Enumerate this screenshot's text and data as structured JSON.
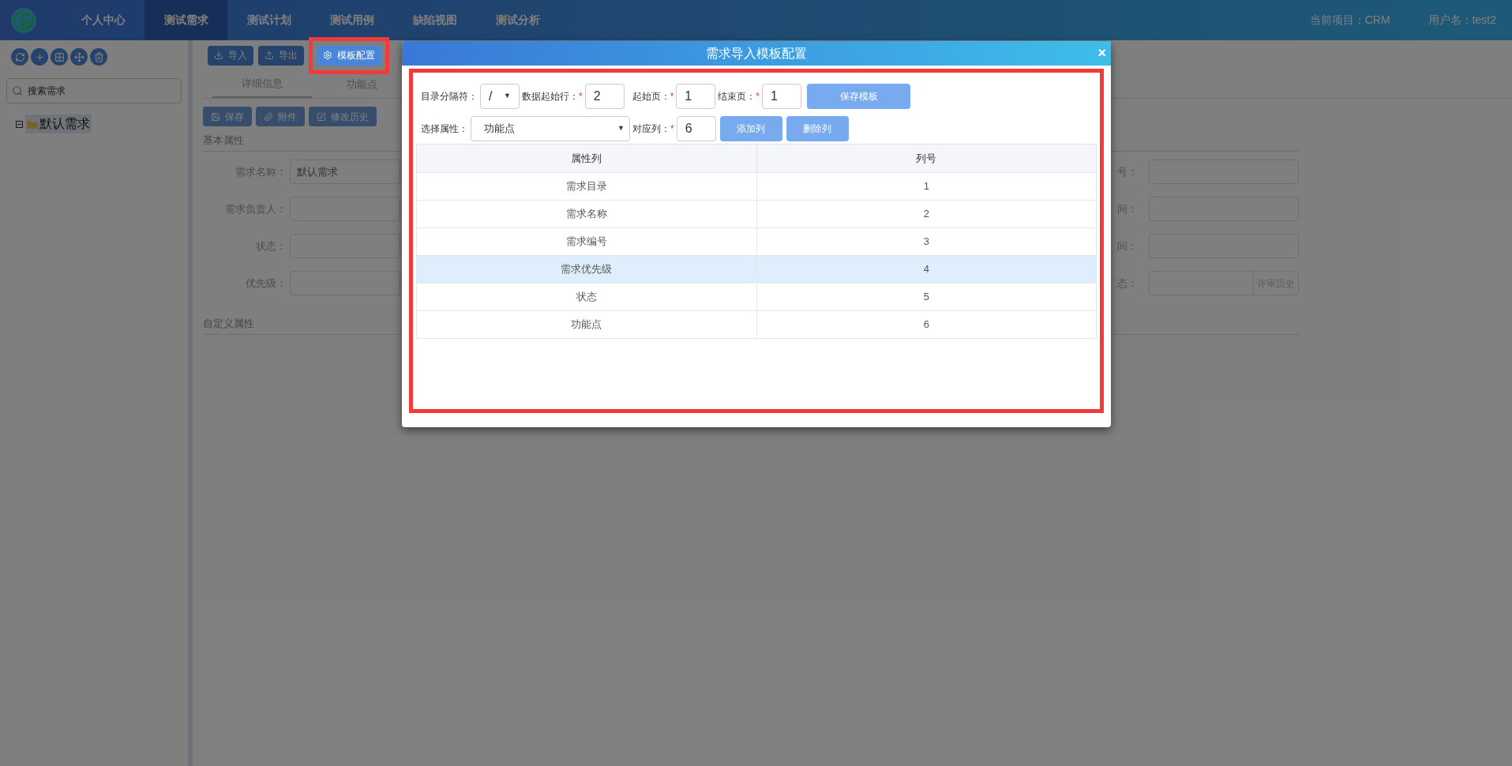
{
  "nav": {
    "items": [
      {
        "label": "个人中心",
        "selected": false
      },
      {
        "label": "测试需求",
        "selected": true
      },
      {
        "label": "测试计划",
        "selected": false
      },
      {
        "label": "测试用例",
        "selected": false
      },
      {
        "label": "缺陷视图",
        "selected": false
      },
      {
        "label": "测试分析",
        "selected": false
      }
    ],
    "project": "当前项目：CRM",
    "user": "用户名：test2"
  },
  "sidebar": {
    "tools": [
      {
        "kind": "refresh"
      },
      {
        "kind": "add"
      },
      {
        "kind": "grid"
      },
      {
        "kind": "move"
      },
      {
        "kind": "delete"
      }
    ],
    "search": {
      "placeholder": "搜索需求"
    },
    "tree": [
      {
        "label": "默认需求",
        "expanded": true,
        "selected": true
      }
    ]
  },
  "toolbar": [
    {
      "kind": "import",
      "label": "导入",
      "highlighted": false
    },
    {
      "kind": "export",
      "label": "导出",
      "highlighted": false
    },
    {
      "kind": "settings",
      "label": "模板配置",
      "highlighted": true
    }
  ],
  "detail": {
    "tabs": [
      {
        "label": "详细信息",
        "selected": true
      },
      {
        "label": "功能点",
        "selected": false
      }
    ],
    "actions": [
      {
        "kind": "save",
        "label": "保存"
      },
      {
        "kind": "attach",
        "label": "附件"
      },
      {
        "kind": "edit",
        "label": "修改历史"
      }
    ],
    "section": "基本属性",
    "rows": [
      {
        "label": "需求名称：",
        "value": "默认需求",
        "right_label": "号："
      },
      {
        "label": "需求负责人：",
        "right_label": "间："
      },
      {
        "label": "状态：",
        "right_label": "间："
      },
      {
        "label": "优先级：",
        "right_label": "态：",
        "right_addon": "评审历史"
      }
    ],
    "custom_section": "自定义属性"
  },
  "dialog": {
    "title": "需求导入模板配置",
    "close": "×",
    "highlighted": true,
    "separator": {
      "label": "目录分隔符：",
      "value": "/",
      "caret": "▼"
    },
    "start_row": {
      "label": "数据起始行：",
      "required_mark": "*",
      "value": "2"
    },
    "start_page": {
      "label": "起始页：",
      "required_mark": "*",
      "value": "1"
    },
    "end_page": {
      "label": "结束页：",
      "required_mark": "*",
      "value": "1"
    },
    "save_button": "保存模板",
    "attribute": {
      "label": "选择属性：",
      "value": "功能点",
      "caret": "▼"
    },
    "column": {
      "label": "对应列：",
      "required_mark": "*",
      "value": "6"
    },
    "add_button": "添加列",
    "delete_button": "删除列",
    "table": {
      "columns": [
        "属性列",
        "列号"
      ],
      "rows": [
        {
          "cells": [
            "需求目录",
            "1"
          ],
          "selected": false
        },
        {
          "cells": [
            "需求名称",
            "2"
          ],
          "selected": false
        },
        {
          "cells": [
            "需求编号",
            "3"
          ],
          "selected": false
        },
        {
          "cells": [
            "需求优先级",
            "4"
          ],
          "selected": true
        },
        {
          "cells": [
            "状态",
            "5"
          ],
          "selected": false
        },
        {
          "cells": [
            "功能点",
            "6"
          ],
          "selected": false
        }
      ]
    }
  }
}
